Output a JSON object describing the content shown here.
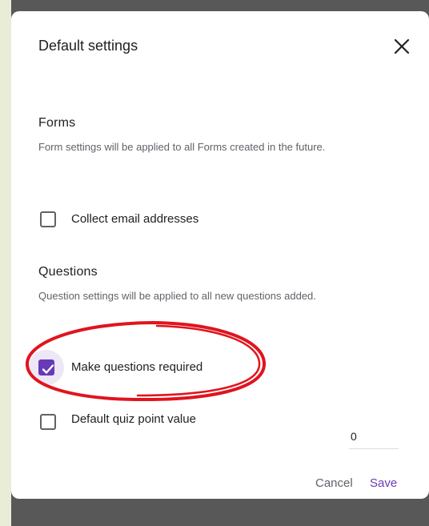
{
  "dialog": {
    "title": "Default settings",
    "close_icon": "close-icon"
  },
  "forms": {
    "heading": "Forms",
    "description": "Form settings will be applied to all Forms created in the future.",
    "collect_email": {
      "label": "Collect email addresses",
      "checked": false
    }
  },
  "questions": {
    "heading": "Questions",
    "description": "Question settings will be applied to all new questions added.",
    "make_required": {
      "label": "Make questions required",
      "checked": true
    },
    "default_points": {
      "label": "Default quiz point value",
      "checked": false,
      "value": "0"
    }
  },
  "actions": {
    "cancel_label": "Cancel",
    "save_label": "Save"
  },
  "colors": {
    "accent": "#673ab7",
    "annotation": "#e0141e",
    "backdrop": "#585858",
    "side_strip": "#e9ecd7"
  },
  "annotation": {
    "shape": "hand-drawn-ellipse",
    "target": "make-questions-required"
  }
}
